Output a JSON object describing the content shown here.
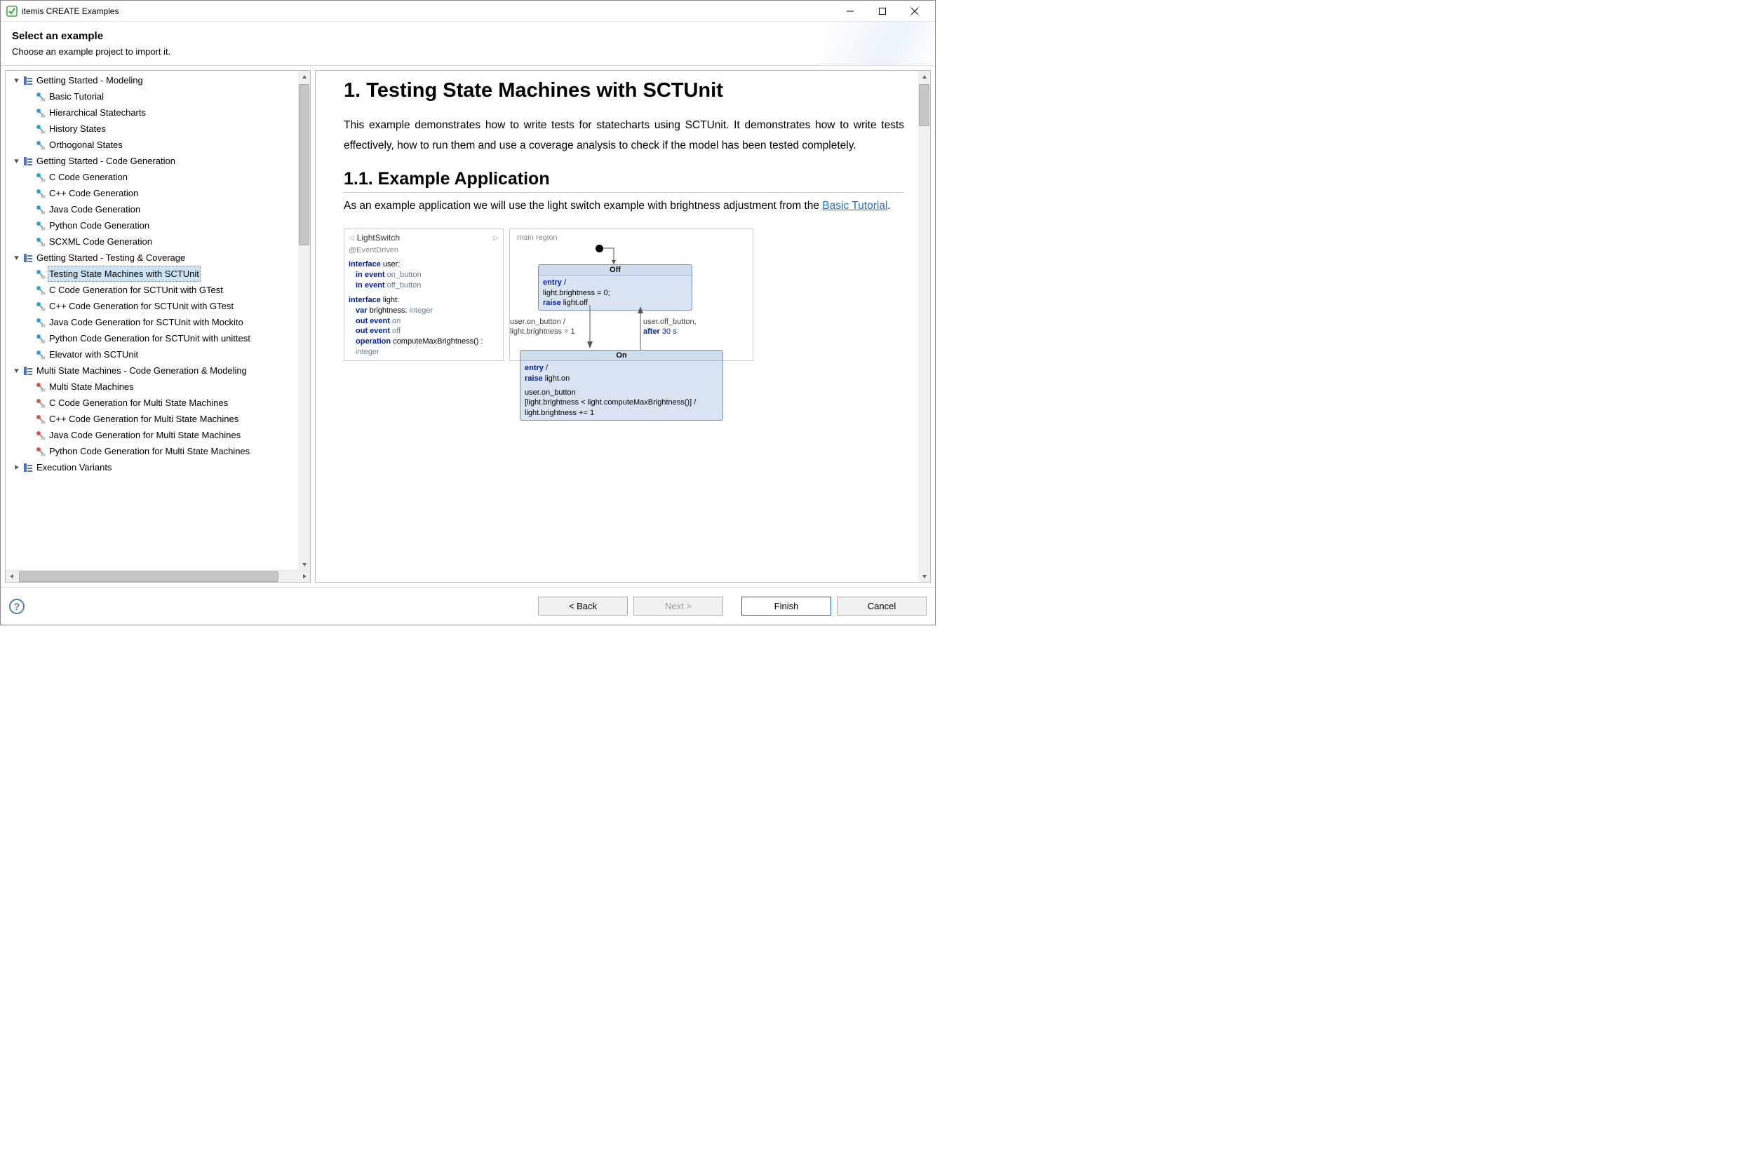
{
  "window": {
    "title": "itemis CREATE Examples"
  },
  "header": {
    "title": "Select an example",
    "subtitle": "Choose an example project to import it."
  },
  "tree": {
    "groups": [
      {
        "label": "Getting Started - Modeling",
        "expanded": true,
        "selectedIndex": null,
        "items": [
          {
            "label": "Basic Tutorial"
          },
          {
            "label": "Hierarchical Statecharts"
          },
          {
            "label": "History States"
          },
          {
            "label": "Orthogonal States"
          }
        ]
      },
      {
        "label": "Getting Started - Code Generation",
        "expanded": true,
        "selectedIndex": null,
        "items": [
          {
            "label": "C Code Generation"
          },
          {
            "label": "C++ Code Generation"
          },
          {
            "label": "Java Code Generation"
          },
          {
            "label": "Python Code Generation"
          },
          {
            "label": "SCXML Code Generation"
          }
        ]
      },
      {
        "label": "Getting Started - Testing & Coverage",
        "expanded": true,
        "selectedIndex": 0,
        "items": [
          {
            "label": "Testing State Machines with SCTUnit"
          },
          {
            "label": "C Code Generation for SCTUnit with GTest"
          },
          {
            "label": "C++ Code Generation for SCTUnit with GTest"
          },
          {
            "label": "Java Code Generation for SCTUnit with Mockito"
          },
          {
            "label": "Python Code Generation for SCTUnit with unittest"
          },
          {
            "label": "Elevator with SCTUnit"
          }
        ]
      },
      {
        "label": "Multi State Machines - Code Generation & Modeling",
        "expanded": true,
        "selectedIndex": null,
        "items": [
          {
            "label": "Multi State Machines"
          },
          {
            "label": "C Code Generation for Multi State Machines"
          },
          {
            "label": "C++ Code Generation for Multi State Machines"
          },
          {
            "label": "Java Code Generation for Multi State Machines"
          },
          {
            "label": "Python Code Generation for Multi State Machines"
          }
        ]
      },
      {
        "label": "Execution Variants",
        "expanded": false,
        "selectedIndex": null,
        "items": []
      }
    ]
  },
  "content": {
    "h1": "1. Testing State Machines with SCTUnit",
    "p1": "This example demonstrates how to write tests for statecharts using SCTUnit. It demonstrates how to write tests effectively, how to run them and use a coverage analysis to check if the model has been tested completely.",
    "h2": "1.1. Example Application",
    "p2a": "As an example application we will use the light switch example with brightness adjustment from the ",
    "p2link": "Basic Tutorial",
    "p2b": ".",
    "diagram": {
      "leftTitle": "LightSwitch",
      "leftAnnot": "@EventDriven",
      "regionLabel": "main region",
      "offTitle": "Off",
      "offBody1a": "entry",
      "offBody1b": " /",
      "offBody2": "light.brightness = 0;",
      "offBody3a": "raise ",
      "offBody3b": "light.off",
      "onTitle": "On",
      "onBody1a": "entry",
      "onBody1b": " /",
      "onBody2a": "raise ",
      "onBody2b": "light.on",
      "onBody3": "user.on_button",
      "onBody4": "[light.brightness < light.computeMaxBrightness()] /",
      "onBody5": "light.brightness += 1",
      "transL1": "user.on_button /",
      "transL2": "light.brightness = 1",
      "transR1": "user.off_button,",
      "transR2a": "after ",
      "transR2b": "30 s"
    }
  },
  "footer": {
    "back": "< Back",
    "next": "Next >",
    "finish": "Finish",
    "cancel": "Cancel"
  }
}
